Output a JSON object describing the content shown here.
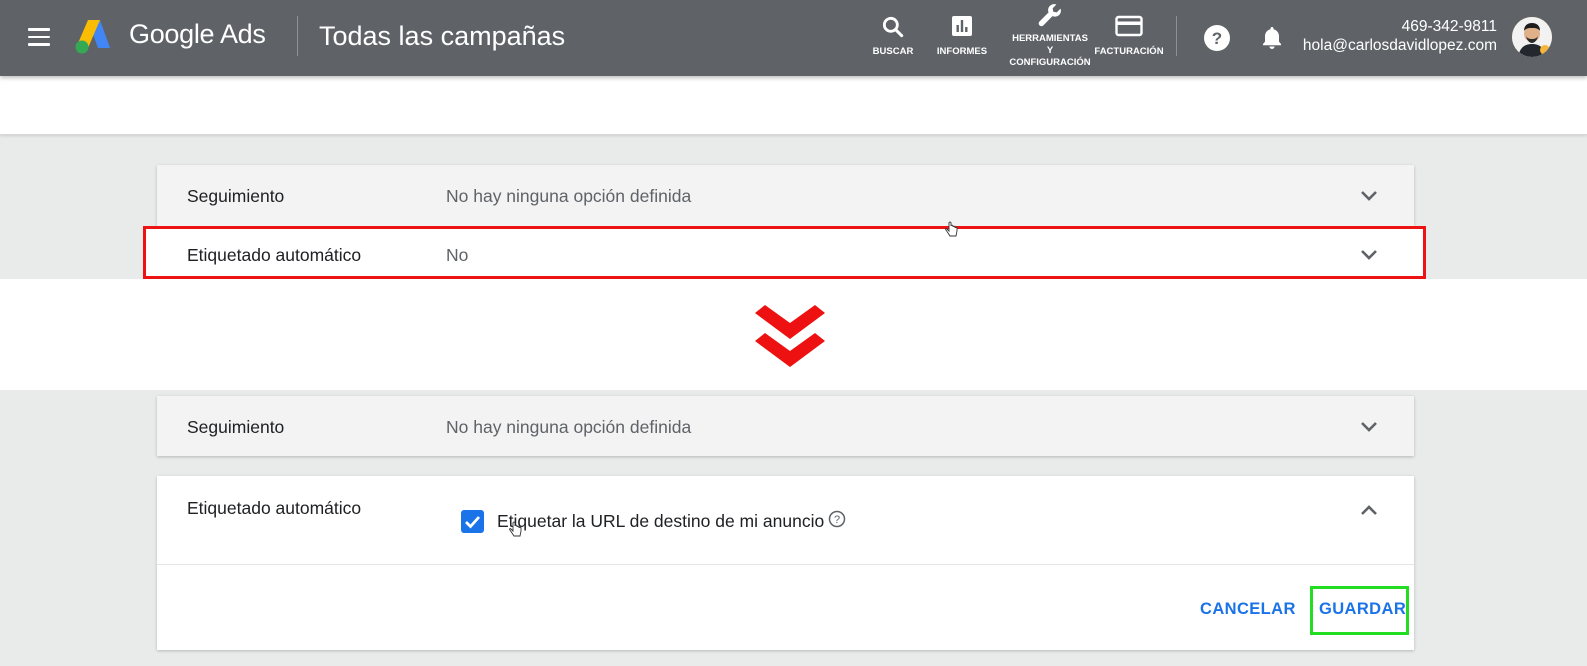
{
  "header": {
    "app_name": "Google Ads",
    "page_title": "Todas las campañas",
    "tools": {
      "search": "BUSCAR",
      "reports": "INFORMES",
      "tools_line1": "HERRAMIENTAS",
      "tools_line2": "Y",
      "tools_line3": "CONFIGURACIÓN",
      "billing": "FACTURACIÓN"
    },
    "account_phone": "469-342-9811",
    "account_email": "hola@carlosdavidlopez.com"
  },
  "before": {
    "tracking": {
      "label": "Seguimiento",
      "value": "No hay ninguna opción definida"
    },
    "auto_tagging": {
      "label": "Etiquetado automático",
      "value": "No"
    }
  },
  "after": {
    "tracking": {
      "label": "Seguimiento",
      "value": "No hay ninguna opción definida"
    },
    "auto_tagging": {
      "label": "Etiquetado automático",
      "checkbox_label": "Etiquetar la URL de destino de mi anuncio",
      "checked": true,
      "cancel": "CANCELAR",
      "save": "GUARDAR"
    }
  },
  "colors": {
    "header_bg": "#5f6368",
    "accent_blue": "#1a73e8",
    "highlight_red": "#ee1313",
    "highlight_green": "#22dd22"
  }
}
